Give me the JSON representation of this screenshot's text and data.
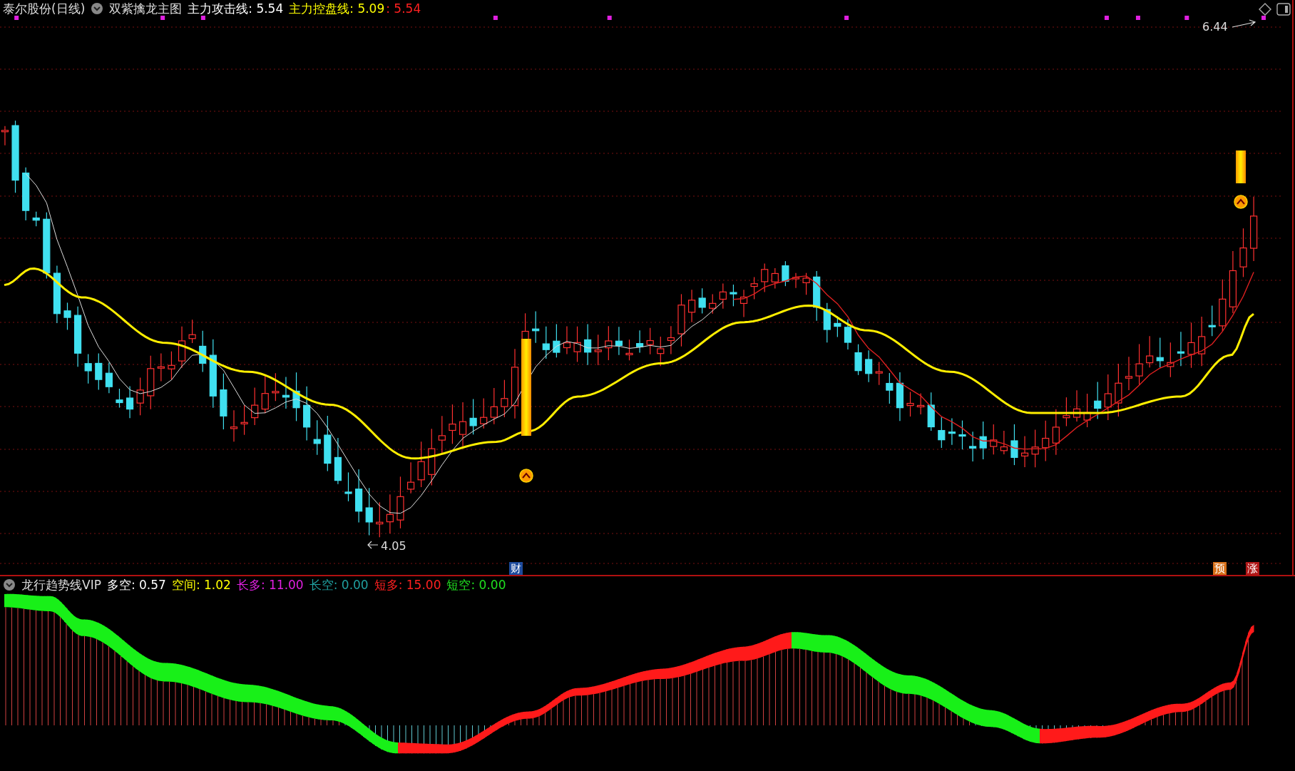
{
  "main_chart": {
    "title": "泰尔股份(日线)",
    "indicator": "双紫擒龙主图",
    "readings": [
      {
        "text": "主力攻击线: 5.54",
        "color": "#ffffff"
      },
      {
        "text": "主力控盘线: 5.09",
        "color": "#ffff00"
      },
      {
        "text": ": 5.54",
        "color": "#ff2020"
      }
    ],
    "high_label": "6.44",
    "low_label": "4.05",
    "markers": [
      {
        "text": "财",
        "color": "#1c4a9c"
      },
      {
        "text": "预",
        "color": "#d8701a"
      },
      {
        "text": "涨",
        "color": "#b01818"
      }
    ]
  },
  "sub_chart": {
    "indicator": "龙行趋势线VIP",
    "readings": [
      {
        "text": "多空: 0.57",
        "color": "#ffffff"
      },
      {
        "text": "空间: 1.02",
        "color": "#ffff00"
      },
      {
        "text": "长多: 11.00",
        "color": "#e020e0"
      },
      {
        "text": "长空: 0.00",
        "color": "#20a0a0"
      },
      {
        "text": "短多: 15.00",
        "color": "#ff2020"
      },
      {
        "text": "短空: 0.00",
        "color": "#20e020"
      }
    ]
  }
}
